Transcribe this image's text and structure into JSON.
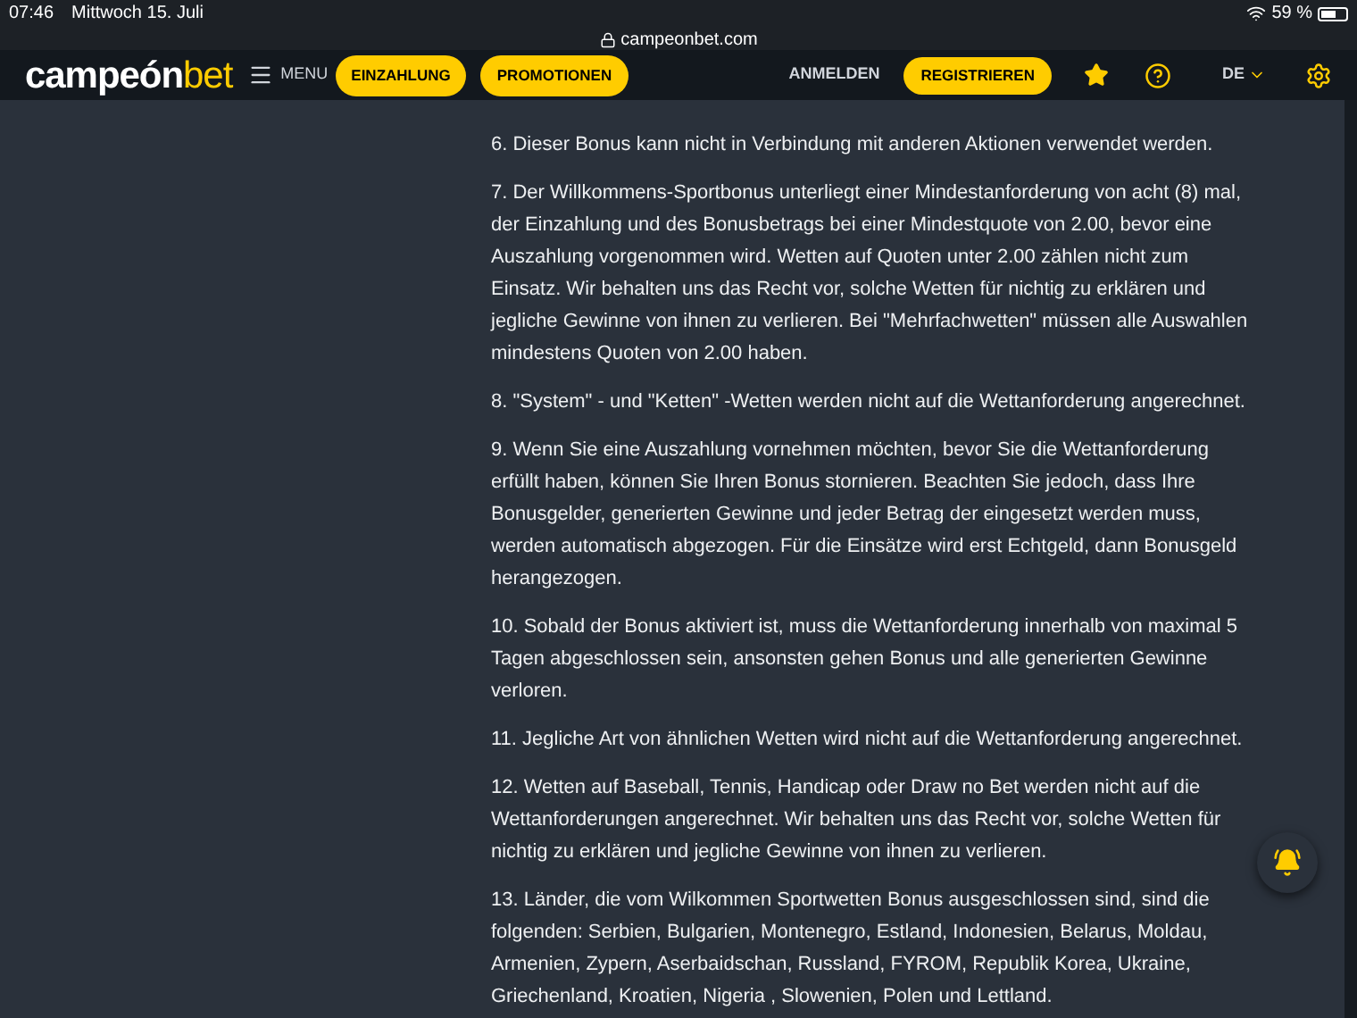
{
  "status_bar": {
    "time": "07:46",
    "date": "Mittwoch 15. Juli",
    "battery": "59 %"
  },
  "address_bar": {
    "url": "campeonbet.com"
  },
  "nav": {
    "logo_first": "campeón",
    "logo_second": "bet",
    "menu": "MENU",
    "buttons": [
      {
        "label": "EINZAHLUNG",
        "kind": "pill"
      },
      {
        "label": "PROMOTIONEN",
        "kind": "pill"
      }
    ],
    "login": "ANMELDEN",
    "register": "REGISTRIEREN",
    "language": "DE"
  },
  "terms": [
    "6. Dieser Bonus kann nicht in Verbindung mit anderen Aktionen verwendet werden.",
    "7. Der Willkommens-Sportbonus unterliegt einer Mindestanforderung von acht (8) mal, der Einzahlung und des Bonusbetrags bei einer Mindestquote von 2.00, bevor eine Auszahlung vorgenommen wird. Wetten auf Quoten unter 2.00 zählen nicht zum Einsatz. Wir behalten uns das Recht vor, solche Wetten für nichtig zu erklären und jegliche Gewinne von ihnen zu verlieren. Bei \"Mehrfachwetten\" müssen alle Auswahlen mindestens Quoten von 2.00 haben.",
    "8. \"System\" - und \"Ketten\" -Wetten werden nicht auf die Wettanforderung angerechnet.",
    "9. Wenn Sie eine Auszahlung vornehmen möchten, bevor Sie die Wettanforderung erfüllt haben, können Sie Ihren Bonus stornieren. Beachten Sie jedoch, dass Ihre Bonusgelder, generierten Gewinne und jeder Betrag der eingesetzt werden muss, werden automatisch abgezogen. Für die Einsätze wird erst Echtgeld, dann Bonusgeld herangezogen.",
    "10. Sobald der Bonus aktiviert ist, muss die Wettanforderung innerhalb von maximal 5 Tagen abgeschlossen sein, ansonsten gehen Bonus und alle generierten Gewinne verloren.",
    "11. Jegliche Art von ähnlichen Wetten wird nicht auf die Wettanforderung angerechnet.",
    "12. Wetten auf Baseball, Tennis, Handicap oder Draw no Bet werden nicht auf die Wettanforderungen angerechnet. Wir behalten uns das Recht vor, solche Wetten für nichtig zu erklären und jegliche Gewinne von ihnen zu verlieren.",
    "13. Länder, die vom Wilkommen Sportwetten Bonus ausgeschlossen sind, sind die folgenden: Serbien, Bulgarien, Montenegro, Estland, Indonesien, Belarus, Moldau, Armenien, Zypern, Aserbaidschan, Russland, FYROM, Republik Korea, Ukraine, Griechenland, Kroatien, Nigeria , Slowenien, Polen und Lettland."
  ]
}
